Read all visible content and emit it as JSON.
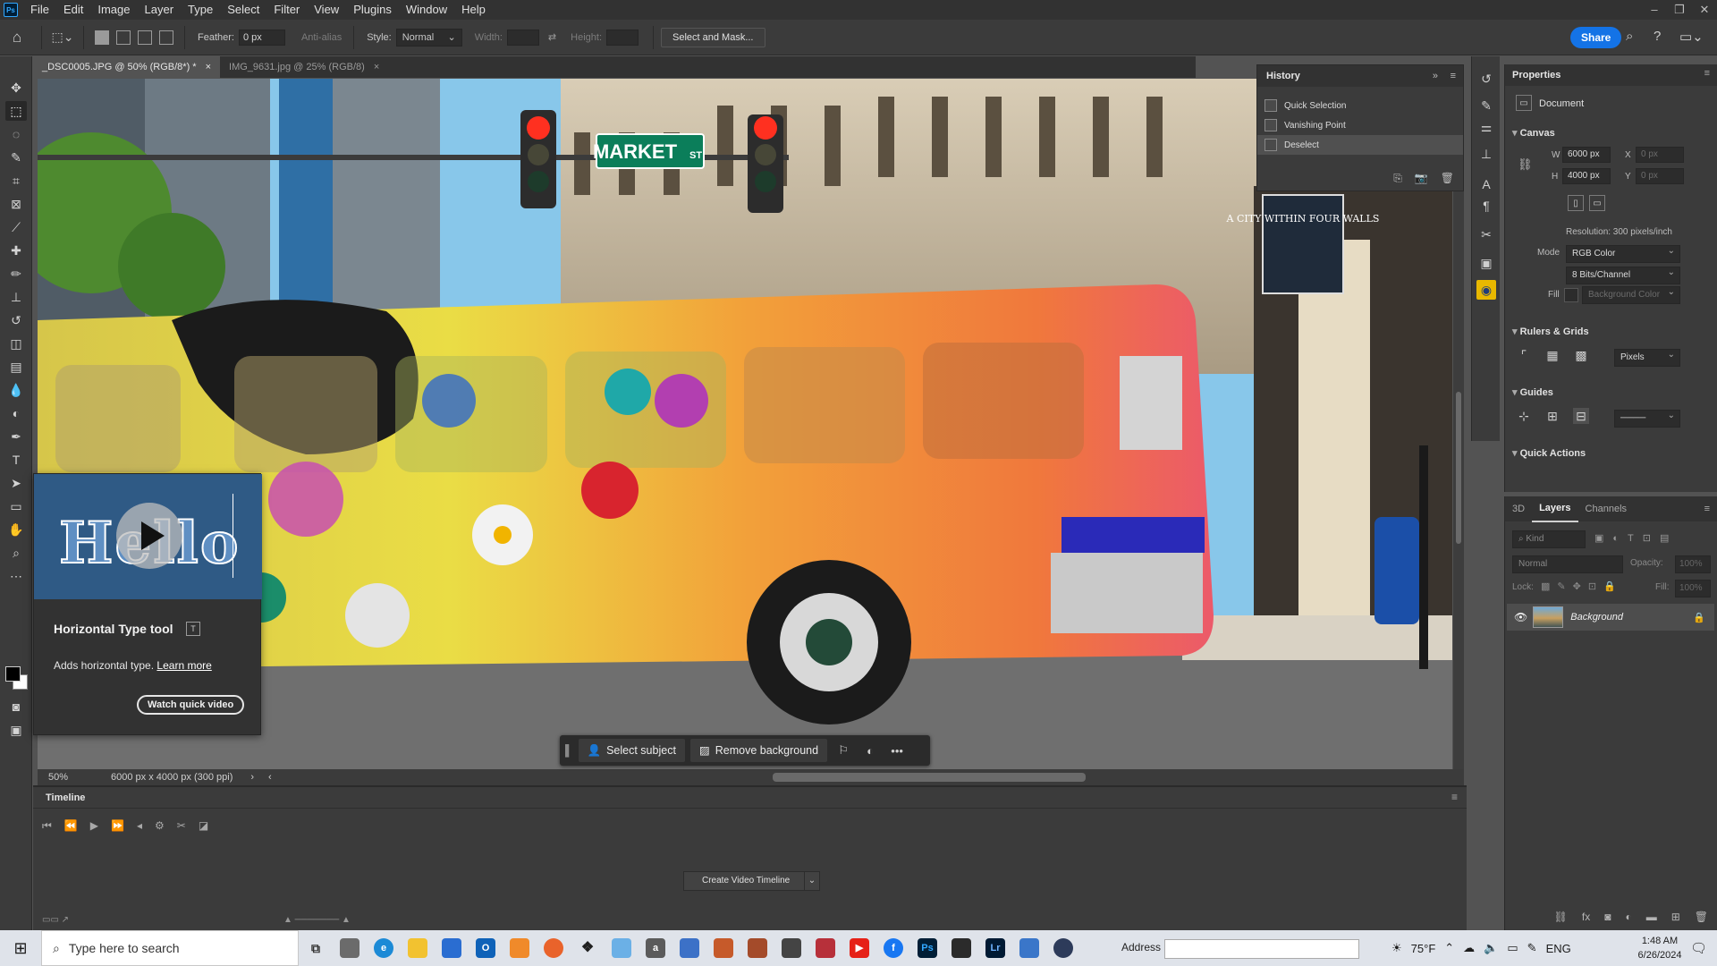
{
  "app": {
    "logo": "Ps"
  },
  "menu": [
    "File",
    "Edit",
    "Image",
    "Layer",
    "Type",
    "Select",
    "Filter",
    "View",
    "Plugins",
    "Window",
    "Help"
  ],
  "window_controls": {
    "minimize": "–",
    "restore": "❐",
    "close": "✕"
  },
  "options": {
    "feather_label": "Feather:",
    "feather_value": "0 px",
    "antialias_label": "Anti-alias",
    "style_label": "Style:",
    "style_value": "Normal",
    "width_label": "Width:",
    "height_label": "Height:",
    "select_mask": "Select and Mask...",
    "share": "Share"
  },
  "tabs": [
    {
      "label": "_DSC0005.JPG @ 50% (RGB/8*) *",
      "close": "×"
    },
    {
      "label": "IMG_9631.jpg @ 25% (RGB/8)",
      "close": "×"
    }
  ],
  "canvas": {
    "street_sign": "MARKET",
    "street_sign_suffix": "ST",
    "poster_text": "A CITY WITHIN FOUR WALLS",
    "colors": {
      "sky": "#88c7ea",
      "bus_start": "#e9dc4a",
      "bus_end": "#ec5a6a",
      "road": "#6f6f6f"
    }
  },
  "status": {
    "zoom": "50%",
    "doc_info": "6000 px x 4000 px (300 ppi)"
  },
  "timeline": {
    "title": "Timeline",
    "create_button": "Create Video Timeline",
    "dropdown": "⌄"
  },
  "history": {
    "title": "History",
    "items": [
      {
        "label": "Quick Selection",
        "selected": false
      },
      {
        "label": "Vanishing Point",
        "selected": false
      },
      {
        "label": "Deselect",
        "selected": true
      }
    ]
  },
  "properties": {
    "title": "Properties",
    "doc_label": "Document",
    "canvas_section": "Canvas",
    "w_label": "W",
    "w_value": "6000 px",
    "h_label": "H",
    "h_value": "4000 px",
    "x_label": "X",
    "x_value": "0 px",
    "y_label": "Y",
    "y_value": "0 px",
    "resolution": "Resolution: 300 pixels/inch",
    "mode_label": "Mode",
    "mode_value": "RGB Color",
    "bits_value": "8 Bits/Channel",
    "fill_label": "Fill",
    "fill_value": "Background Color",
    "rulers_section": "Rulers & Grids",
    "units_value": "Pixels",
    "guides_section": "Guides",
    "quick_actions_section": "Quick Actions"
  },
  "layers": {
    "tabs": [
      "3D",
      "Layers",
      "Channels"
    ],
    "active_tab": "Layers",
    "kind_placeholder": "Kind",
    "blend_mode": "Normal",
    "opacity_label": "Opacity:",
    "opacity_value": "100%",
    "lock_label": "Lock:",
    "fill_label": "Fill:",
    "fill_value": "100%",
    "rows": [
      {
        "name": "Background",
        "visible": true,
        "locked": true
      }
    ]
  },
  "tooltip": {
    "media_text": "Hello",
    "title": "Horizontal Type tool",
    "shortcut": "T",
    "desc": "Adds horizontal type.",
    "link": "Learn more",
    "button": "Watch quick video"
  },
  "context_bar": {
    "select_subject": "Select subject",
    "remove_background": "Remove background",
    "more": "•••"
  },
  "taskbar": {
    "search_placeholder": "Type here to search",
    "address_label": "Address",
    "weather": "75°F",
    "language": "ENG",
    "time": "1:48 AM",
    "date": "6/26/2024"
  }
}
